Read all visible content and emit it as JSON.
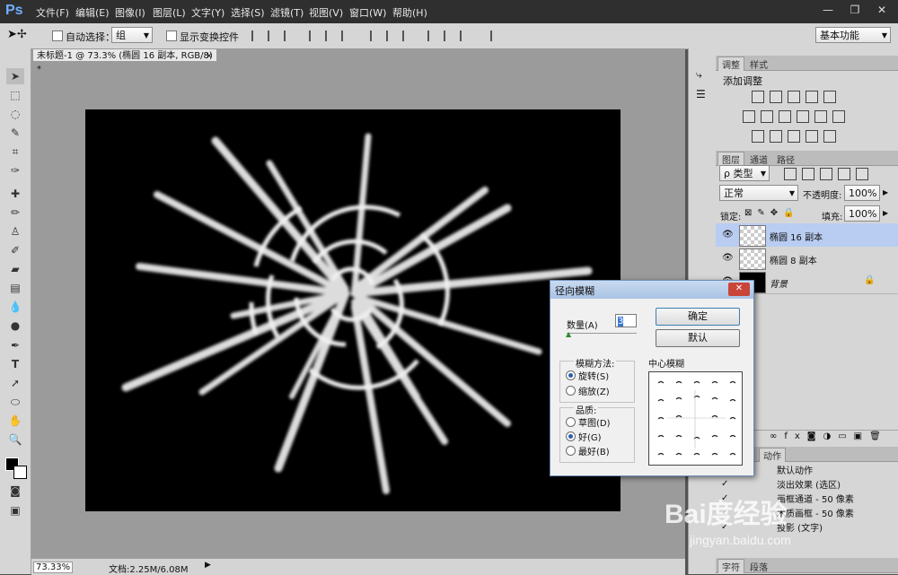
{
  "app": {
    "logo": "Ps"
  },
  "menu": [
    "文件(F)",
    "编辑(E)",
    "图像(I)",
    "图层(L)",
    "文字(Y)",
    "选择(S)",
    "滤镜(T)",
    "视图(V)",
    "窗口(W)",
    "帮助(H)"
  ],
  "window_controls": {
    "minimize": "—",
    "restore": "❐",
    "close": "✕"
  },
  "options": {
    "auto_select_label": "自动选择：",
    "auto_select_value": "组",
    "show_transform_label": "显示变换控件",
    "workspace": "基本功能"
  },
  "document": {
    "tab_title": "未标题-1 @ 73.3% (椭圆 16 副本, RGB/8) *",
    "tab_close": "×"
  },
  "status": {
    "zoom": "73.33%",
    "doc_info": "文档:2.25M/6.08M"
  },
  "panels": {
    "adjust_tabs": [
      "调整",
      "样式"
    ],
    "adjust_title": "添加调整",
    "layer_tabs": [
      "图层",
      "通道",
      "路径"
    ],
    "filter_kind": "类型",
    "blend_mode": "正常",
    "opacity_label": "不透明度:",
    "opacity_value": "100%",
    "lock_label": "锁定:",
    "fill_label": "填充:",
    "fill_value": "100%",
    "layers": [
      {
        "name": "椭圆 16 副本",
        "selected": true
      },
      {
        "name": "椭圆 8 副本",
        "selected": false
      },
      {
        "name": "背景",
        "selected": false
      }
    ],
    "actions_tab": "动作",
    "actions": [
      "默认动作",
      "淡出效果 (选区)",
      "画框通道 - 50 像素",
      "木质画框 - 50 像素",
      "投影 (文字)"
    ],
    "bottom_tabs": [
      "字符",
      "段落"
    ]
  },
  "dialog": {
    "title": "径向模糊",
    "close": "✕",
    "amount_label": "数量(A)",
    "amount_value": "3",
    "ok": "确定",
    "reset": "默认",
    "method_label": "模糊方法:",
    "method_options": [
      "旋转(S)",
      "缩放(Z)"
    ],
    "method_selected": 0,
    "quality_label": "品质:",
    "quality_options": [
      "草图(D)",
      "好(G)",
      "最好(B)"
    ],
    "quality_selected": 1,
    "center_label": "中心模糊"
  },
  "watermark": {
    "line1": "Bai度经验",
    "line2": "jingyan.baidu.com"
  }
}
